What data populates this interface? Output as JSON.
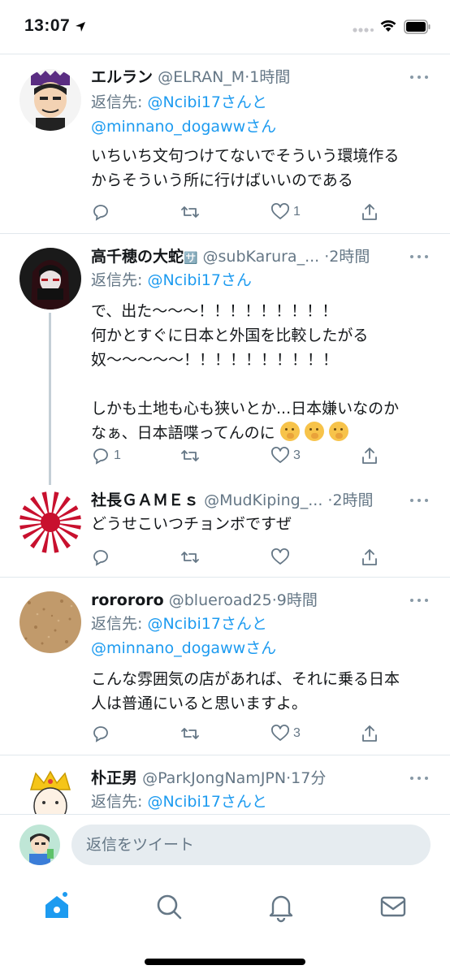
{
  "status_bar": {
    "time": "13:07"
  },
  "tweets": [
    {
      "name": "エルラン",
      "handle": "@ELRAN_M",
      "dot": "·",
      "ago": "1時間",
      "reply_prefix": "返信先: ",
      "reply_line1_link": "@Ncibi17さんと",
      "reply_line2_link": "@minnano_dogawwさん",
      "lines": [
        "いちいち文句つけてないでそういう環境作る",
        "からそういう所に行けばいいのである"
      ],
      "replies": "",
      "retweets": "",
      "likes": "1"
    },
    {
      "name": "高千穂の大蛇",
      "name_suffix": "🈂️",
      "handle": "@subKarura_...",
      "dot": "·",
      "ago": "2時間",
      "reply_prefix": "返信先: ",
      "reply_line1_link": "@Ncibi17さん",
      "lines": [
        "で、出た〜〜〜！！！！！！！！！",
        "何かとすぐに日本と外国を比較したがる",
        "奴〜〜〜〜〜！！！！！！！！！！",
        "",
        "しかも土地も心も狭いとか...日本嫌いなのか",
        "なぁ、日本語喋ってんのに"
      ],
      "replies": "1",
      "retweets": "",
      "likes": "3"
    },
    {
      "name": "社長ＧＡＭＥｓ",
      "handle": "@MudKiping_...",
      "dot": "·",
      "ago": "2時間",
      "lines": [
        "どうせこいつチョンボですぜ"
      ],
      "replies": "",
      "retweets": "",
      "likes": ""
    },
    {
      "name": "rorororo",
      "handle": "@blueroad25",
      "dot": "·",
      "ago": "9時間",
      "reply_prefix": "返信先: ",
      "reply_line1_link": "@Ncibi17さんと",
      "reply_line2_link": "@minnano_dogawwさん",
      "lines": [
        "こんな雰囲気の店があれば、それに乗る日本",
        "人は普通にいると思いますよ。"
      ],
      "replies": "",
      "retweets": "",
      "likes": "3"
    },
    {
      "name": "朴正男",
      "handle": "@ParkJongNamJPN",
      "dot": "·",
      "ago": "17分",
      "reply_prefix": "返信先: ",
      "reply_line1_link": "@Ncibi17さんと"
    }
  ],
  "compose": {
    "placeholder": "返信をツイート"
  },
  "colors": {
    "link": "#1d9bf0",
    "meta": "#657786",
    "divider": "#e1e8ed",
    "input_bg": "#e6ecf0"
  },
  "icons": [
    "reply-icon",
    "retweet-icon",
    "like-icon",
    "share-icon",
    "more-icon",
    "home-icon",
    "search-icon",
    "bell-icon",
    "mail-icon"
  ]
}
